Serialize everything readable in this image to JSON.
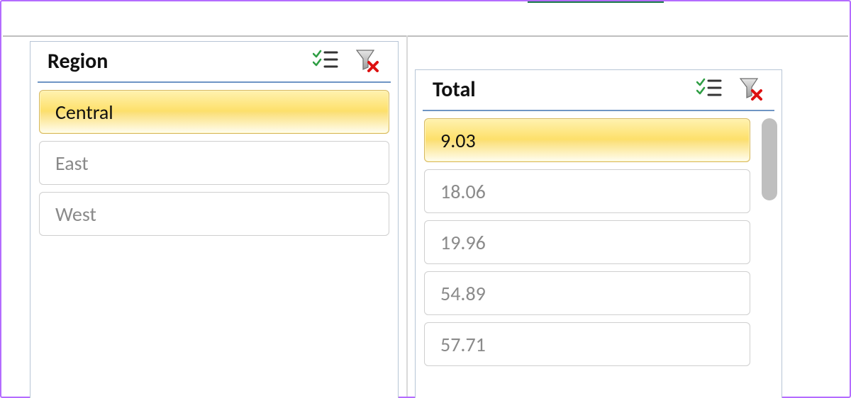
{
  "slicers": {
    "region": {
      "title": "Region",
      "items": [
        {
          "label": "Central",
          "selected": true
        },
        {
          "label": "East",
          "selected": false
        },
        {
          "label": "West",
          "selected": false
        }
      ]
    },
    "total": {
      "title": "Total",
      "items": [
        {
          "label": "9.03",
          "selected": true
        },
        {
          "label": "18.06",
          "selected": false
        },
        {
          "label": "19.96",
          "selected": false
        },
        {
          "label": "54.89",
          "selected": false
        },
        {
          "label": "57.71",
          "selected": false
        }
      ]
    }
  },
  "icons": {
    "multiselect": "multi-select-icon",
    "clearfilter": "clear-filter-icon"
  }
}
